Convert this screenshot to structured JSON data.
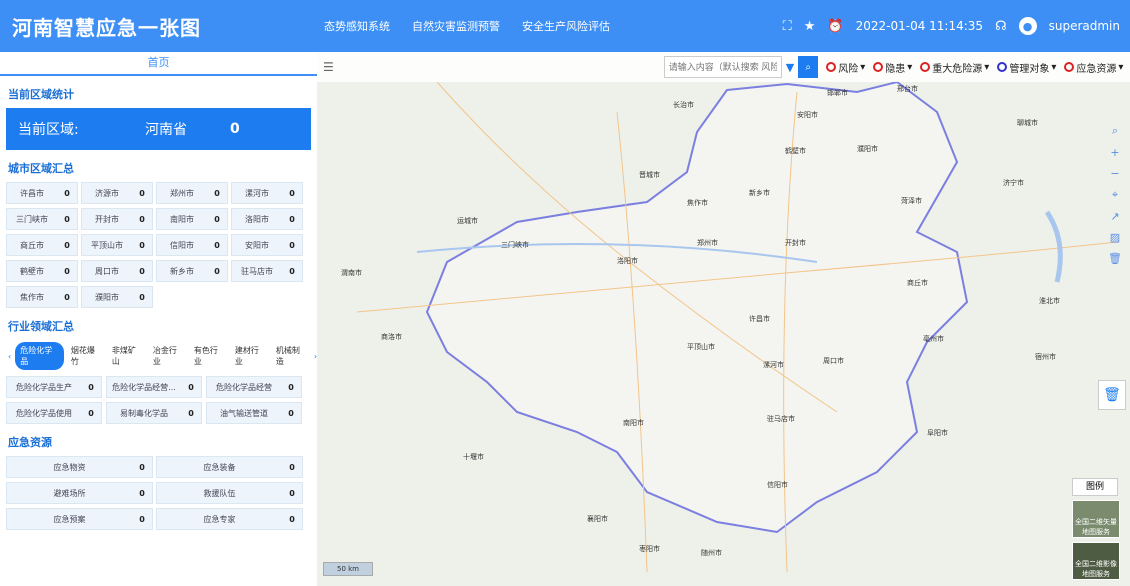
{
  "header": {
    "title": "河南智慧应急一张图",
    "nav": [
      "态势感知系统",
      "自然灾害监测预警",
      "安全生产风险评估"
    ],
    "datetime": "2022-01-04 11:14:35",
    "user": "superadmin"
  },
  "sidebar": {
    "home_tab": "首页",
    "region_stats_title": "当前区域统计",
    "region_label": "当前区域:",
    "region_name": "河南省",
    "region_count": "0",
    "city_title": "城市区域汇总",
    "cities": [
      {
        "name": "许昌市",
        "value": "0"
      },
      {
        "name": "济源市",
        "value": "0"
      },
      {
        "name": "郑州市",
        "value": "0"
      },
      {
        "name": "漯河市",
        "value": "0"
      },
      {
        "name": "三门峡市",
        "value": "0"
      },
      {
        "name": "开封市",
        "value": "0"
      },
      {
        "name": "南阳市",
        "value": "0"
      },
      {
        "name": "洛阳市",
        "value": "0"
      },
      {
        "name": "商丘市",
        "value": "0"
      },
      {
        "name": "平顶山市",
        "value": "0"
      },
      {
        "name": "信阳市",
        "value": "0"
      },
      {
        "name": "安阳市",
        "value": "0"
      },
      {
        "name": "鹤壁市",
        "value": "0"
      },
      {
        "name": "周口市",
        "value": "0"
      },
      {
        "name": "新乡市",
        "value": "0"
      },
      {
        "name": "驻马店市",
        "value": "0"
      },
      {
        "name": "焦作市",
        "value": "0"
      },
      {
        "name": "濮阳市",
        "value": "0"
      }
    ],
    "industry_title": "行业领域汇总",
    "industry_tabs": [
      "危险化学品",
      "烟花爆竹",
      "非煤矿山",
      "冶金行业",
      "有色行业",
      "建材行业",
      "机械制造"
    ],
    "industry_items": [
      {
        "name": "危险化学品生产",
        "value": "0"
      },
      {
        "name": "危险化学品经营...",
        "value": "0"
      },
      {
        "name": "危险化学品经营",
        "value": "0"
      },
      {
        "name": "危险化学品使用",
        "value": "0"
      },
      {
        "name": "易制毒化学品",
        "value": "0"
      },
      {
        "name": "油气输送管道",
        "value": "0"
      }
    ],
    "resource_title": "应急资源",
    "resources": [
      {
        "name": "应急物资",
        "value": "0"
      },
      {
        "name": "应急装备",
        "value": "0"
      },
      {
        "name": "避难场所",
        "value": "0"
      },
      {
        "name": "救援队伍",
        "value": "0"
      },
      {
        "name": "应急预案",
        "value": "0"
      },
      {
        "name": "应急专家",
        "value": "0"
      }
    ]
  },
  "map": {
    "search_placeholder": "请输入内容（默认搜索 风险）",
    "layers": [
      "风险",
      "隐患",
      "重大危险源",
      "管理对象",
      "应急资源"
    ],
    "legend": "图例",
    "basemap_vector": "全国二维矢量地图服务",
    "basemap_image": "全国二维影像地图服务",
    "scale": "50 km",
    "cities": [
      "郑州市",
      "洛阳市",
      "开封市",
      "新乡市",
      "焦作市",
      "鹤壁市",
      "安阳市",
      "濮阳市",
      "商丘市",
      "周口市",
      "平顶山市",
      "许昌市",
      "漯河市",
      "驻马店市",
      "南阳市",
      "信阳市",
      "三门峡市",
      "运城市",
      "十堰市",
      "襄阳市",
      "随州市",
      "亳州市",
      "阜阳市",
      "菏泽市",
      "济宁市",
      "晋城市",
      "长治市",
      "邢台市",
      "邯郸市",
      "聊城市",
      "宿州市",
      "淮北市",
      "渭南市",
      "商洛市",
      "枣阳市",
      "安阳市"
    ]
  }
}
